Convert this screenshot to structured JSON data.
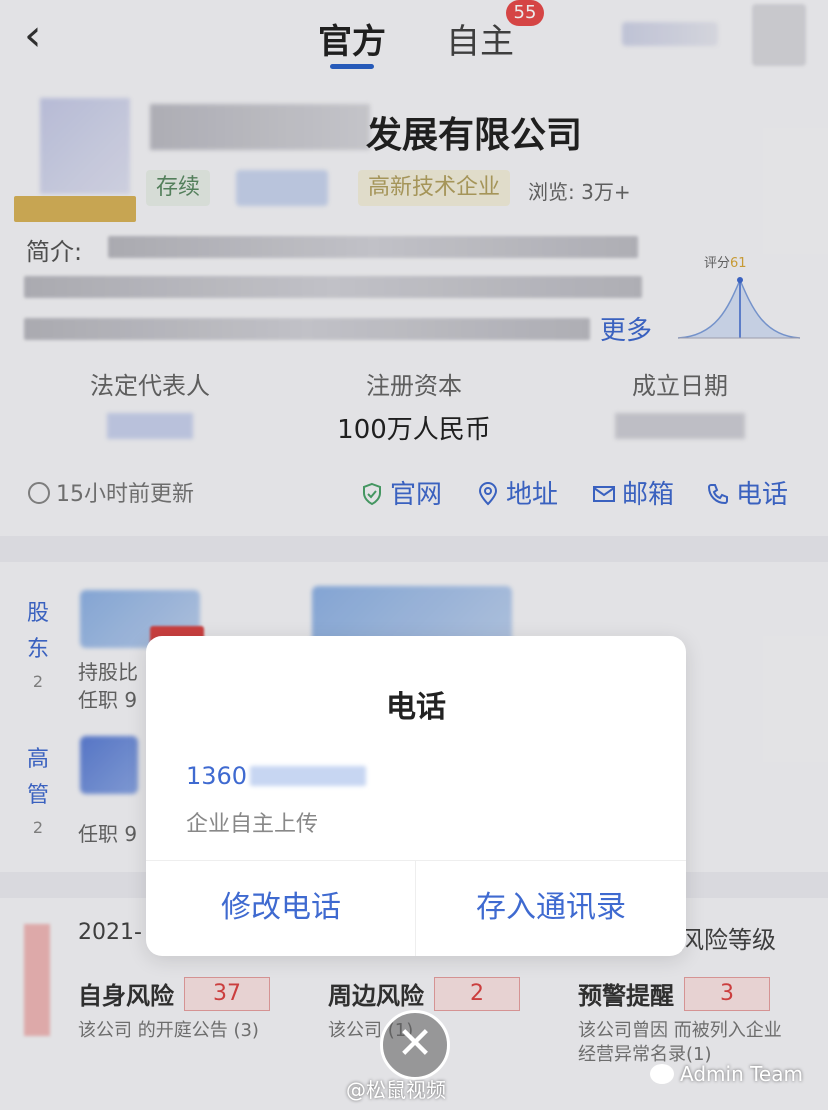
{
  "header": {
    "back_icon": "‹",
    "tab_official": "官方",
    "tab_self": "自主",
    "self_badge": "55"
  },
  "company": {
    "name_suffix": "发展有限公司",
    "status_tag": "存续",
    "hitech_tag": "高新技术企业",
    "views": "浏览: 3万+",
    "intro_label": "简介:",
    "more": "更多",
    "score_label": "评分",
    "score_value": "61"
  },
  "info": {
    "legal_rep_label": "法定代表人",
    "capital_label": "注册资本",
    "capital_value": "100万人民币",
    "founded_label": "成立日期"
  },
  "actions": {
    "updated": "15小时前更新",
    "website": "官网",
    "address": "地址",
    "email": "邮箱",
    "phone": "电话"
  },
  "shareholders": {
    "label_shareholder_1": "股",
    "label_shareholder_2": "东",
    "shareholder_count": "2",
    "label_exec_1": "高",
    "label_exec_2": "管",
    "exec_count": "2",
    "ratio_text": "持股比",
    "role_text_1": "任职 9",
    "role_text_2": "任职 9"
  },
  "risk": {
    "year": "2021-",
    "level_label": "风险等级",
    "self_title": "自身风险",
    "self_count": "37",
    "self_desc": "该公司 的开庭公告 (3)",
    "peripheral_title": "周边风险",
    "peripheral_count": "2",
    "peripheral_desc": "该公司 (1)",
    "warning_title": "预警提醒",
    "warning_count": "3",
    "warning_desc": "该公司曾因 而被列入企业经营异常名录(1)"
  },
  "modal": {
    "title": "电话",
    "phone_prefix": "1360",
    "source": "企业自主上传",
    "edit_button": "修改电话",
    "save_button": "存入通讯录",
    "close_icon": "✕"
  },
  "watermark": {
    "left": "@松鼠视频",
    "right": "Admin Team"
  },
  "colors": {
    "accent": "#3f6ad0",
    "badge": "#e84b4b",
    "risk": "#d44444"
  }
}
